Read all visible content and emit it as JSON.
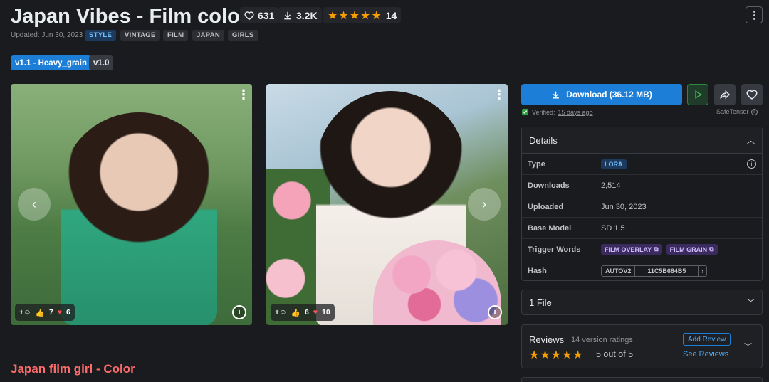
{
  "header": {
    "title": "Japan Vibes - Film color",
    "likes": "631",
    "downloads": "3.2K",
    "rating_count": "14",
    "updated": "Updated: Jun 30, 2023",
    "tags": [
      "STYLE",
      "VINTAGE",
      "FILM",
      "JAPAN",
      "GIRLS"
    ]
  },
  "versions": [
    "v1.1 - Heavy_grain",
    "v1.0"
  ],
  "gallery": [
    {
      "reactions": {
        "like": "7",
        "heart": "6"
      },
      "icons": [
        "add-reaction-icon",
        "thumbs-up-icon",
        "heart-icon",
        "info-icon"
      ]
    },
    {
      "reactions": {
        "like": "6",
        "heart": "10"
      },
      "icons": [
        "add-reaction-icon",
        "thumbs-up-icon",
        "heart-icon",
        "info-icon"
      ]
    }
  ],
  "subtitle": "Japan film girl - Color",
  "download": {
    "label": "Download (36.12 MB)",
    "verified": "Verified:",
    "verified_when": "15 days ago",
    "safetensor": "SafeTensor"
  },
  "details": {
    "header": "Details",
    "rows": {
      "type_k": "Type",
      "type_v": "LORA",
      "downloads_k": "Downloads",
      "downloads_v": "2,514",
      "uploaded_k": "Uploaded",
      "uploaded_v": "Jun 30, 2023",
      "base_k": "Base Model",
      "base_v": "SD 1.5",
      "trigger_k": "Trigger Words",
      "trigger_1": "FILM OVERLAY",
      "trigger_2": "FILM GRAIN",
      "hash_k": "Hash",
      "hash_type": "AUTOV2",
      "hash_value": "11C5B684B5"
    }
  },
  "files": {
    "label": "1 File"
  },
  "reviews": {
    "title": "Reviews",
    "count": "14 version ratings",
    "score": "5 out of 5",
    "add": "Add Review",
    "see": "See Reviews"
  },
  "colors": {
    "accent": "#1c7ed6",
    "star": "#f59f00",
    "subtitle": "#ff6b6b",
    "bg": "#1a1b1e"
  }
}
